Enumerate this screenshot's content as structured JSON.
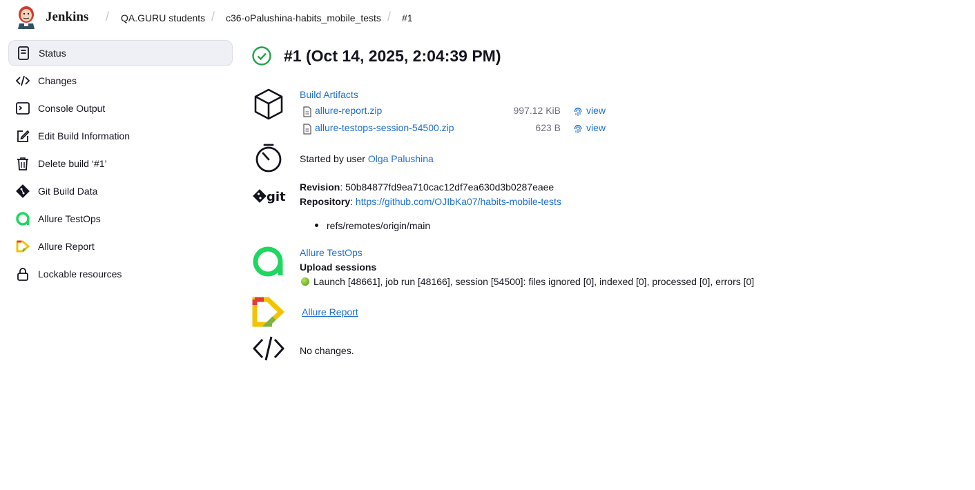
{
  "header": {
    "brand": "Jenkins",
    "breadcrumbs": [
      "QA.GURU students",
      "c36-oPalushina-habits_mobile_tests",
      "#1"
    ]
  },
  "sidebar": {
    "items": [
      {
        "label": "Status",
        "icon": "status-icon"
      },
      {
        "label": "Changes",
        "icon": "code-icon"
      },
      {
        "label": "Console Output",
        "icon": "terminal-icon"
      },
      {
        "label": "Edit Build Information",
        "icon": "edit-icon"
      },
      {
        "label": "Delete build ‘#1’",
        "icon": "trash-icon"
      },
      {
        "label": "Git Build Data",
        "icon": "git-icon"
      },
      {
        "label": "Allure TestOps",
        "icon": "allure-testops-icon"
      },
      {
        "label": "Allure Report",
        "icon": "allure-report-icon"
      },
      {
        "label": "Lockable resources",
        "icon": "lock-icon"
      }
    ]
  },
  "build": {
    "title": "#1 (Oct 14, 2025, 2:04:39 PM)",
    "status_color": "#1ea446"
  },
  "artifacts": {
    "heading": "Build Artifacts",
    "files": [
      {
        "name": "allure-report.zip",
        "size": "997.12 KiB",
        "view": "view"
      },
      {
        "name": "allure-testops-session-54500.zip",
        "size": "623 B",
        "view": "view"
      }
    ]
  },
  "started": {
    "prefix": "Started by user",
    "user": "Olga Palushina"
  },
  "git": {
    "revision_label": "Revision",
    "revision": "50b84877fd9ea710cac12df7ea630d3b0287eaee",
    "repository_label": "Repository",
    "repository": "https://github.com/OJIbKa07/habits-mobile-tests",
    "branches": [
      "refs/remotes/origin/main"
    ]
  },
  "testops": {
    "link": "Allure TestOps",
    "heading": "Upload sessions",
    "session": "Launch [48661], job run [48166], session [54500]: files ignored [0], indexed [0], processed [0], errors [0]"
  },
  "allure_report": {
    "link": "Allure Report"
  },
  "changes": {
    "text": "No changes."
  },
  "colors": {
    "link": "#1e6fd0",
    "allure_green": "#1ed760"
  }
}
